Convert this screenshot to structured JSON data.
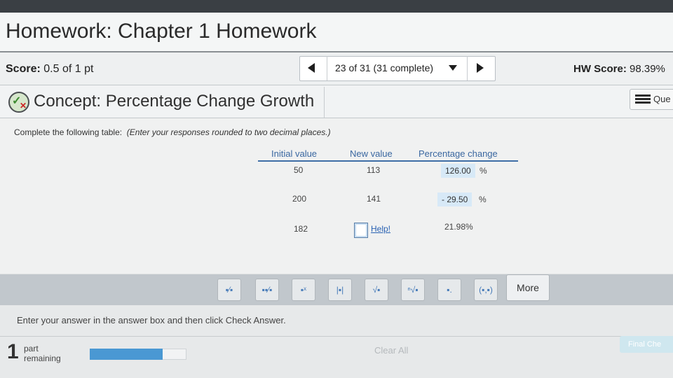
{
  "header": {
    "title": "Homework: Chapter 1 Homework"
  },
  "score": {
    "label": "Score:",
    "value": "0.5 of 1 pt"
  },
  "nav": {
    "position": "23 of 31 (31 complete)"
  },
  "hw_score": {
    "label": "HW Score:",
    "value": "98.39%"
  },
  "concept": {
    "title": "Concept: Percentage Change Growth",
    "icon": "partial-credit-icon"
  },
  "question_button": {
    "label": "Que"
  },
  "instructions": {
    "text": "Complete the following table:",
    "note": "(Enter your responses rounded to two decimal places.)"
  },
  "table": {
    "headers": [
      "Initial value",
      "New value",
      "Percentage change"
    ],
    "rows": [
      {
        "initial": "50",
        "new": "113",
        "change": "126.00",
        "unit": "%"
      },
      {
        "initial": "200",
        "new": "141",
        "change": "- 29.50",
        "unit": "%"
      },
      {
        "initial": "182",
        "new": "",
        "change": "21.98%"
      }
    ],
    "help_label": "Help!"
  },
  "toolbar": {
    "more_label": "More",
    "tools": [
      "fraction",
      "mixed-number",
      "exponent",
      "absolute-value",
      "square-root",
      "nth-root",
      "subscript",
      "ordered-pair"
    ]
  },
  "footer": {
    "message": "Enter your answer in the answer box and then click Check Answer.",
    "parts_count": "1",
    "parts_line1": "part",
    "parts_line2": "remaining",
    "progress_fraction": 0.75,
    "clear_all": "Clear All",
    "final_check": "Final Che"
  },
  "colors": {
    "accent": "#3a67a0",
    "progress": "#4a98d3",
    "answer_bg": "#d7e9f7"
  }
}
